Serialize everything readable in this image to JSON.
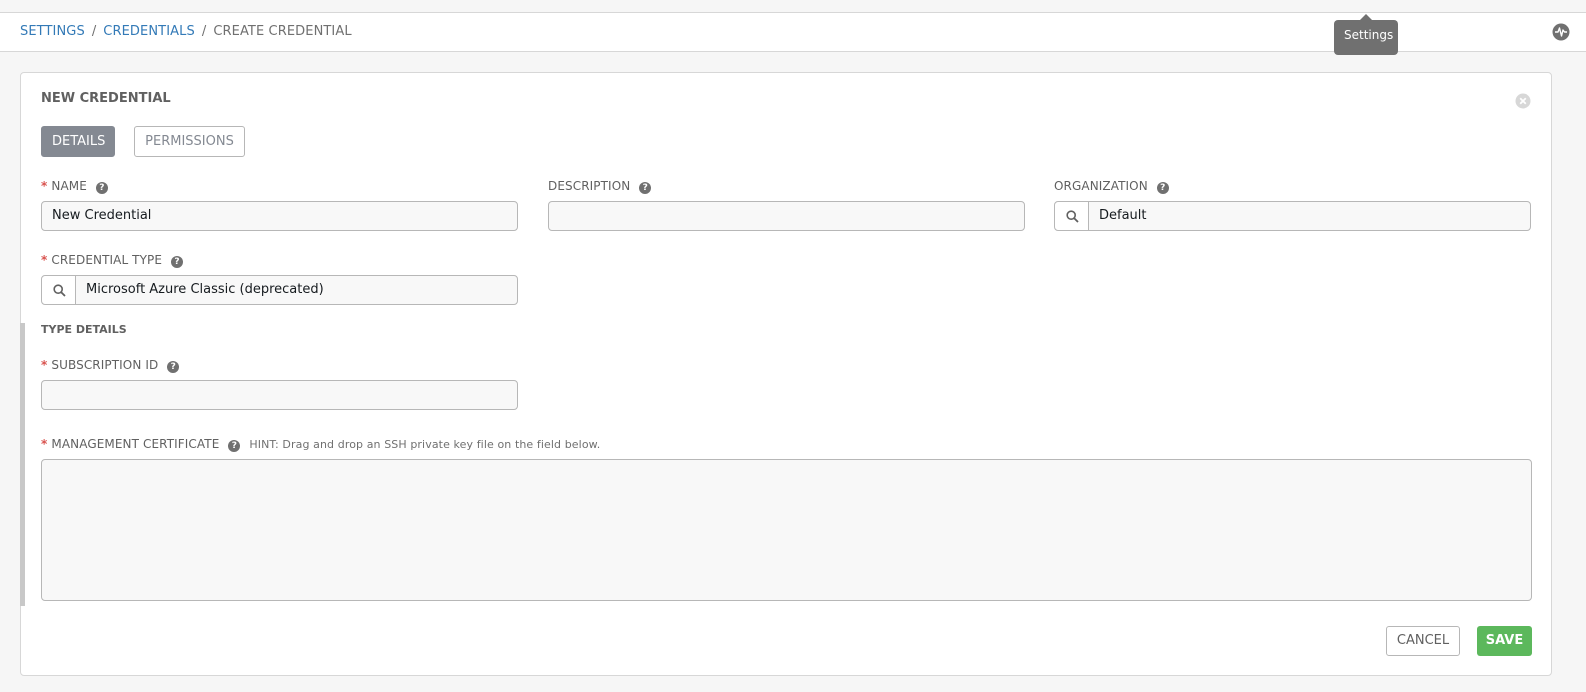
{
  "breadcrumb": {
    "items": [
      "SETTINGS",
      "CREDENTIALS"
    ],
    "current": "CREATE CREDENTIAL",
    "separator": "/"
  },
  "tooltip": {
    "text": "Settings"
  },
  "panel": {
    "title": "NEW CREDENTIAL",
    "tabs": [
      {
        "label": "DETAILS",
        "active": true
      },
      {
        "label": "PERMISSIONS",
        "active": false
      }
    ]
  },
  "form": {
    "name": {
      "label": "NAME",
      "required": true,
      "value": "New Credential"
    },
    "description": {
      "label": "DESCRIPTION",
      "required": false,
      "value": ""
    },
    "organization": {
      "label": "ORGANIZATION",
      "required": false,
      "value": "Default"
    },
    "credential_type": {
      "label": "CREDENTIAL TYPE",
      "required": true,
      "value": "Microsoft Azure Classic (deprecated)"
    },
    "type_details": {
      "title": "TYPE DETAILS"
    },
    "subscription_id": {
      "label": "SUBSCRIPTION ID",
      "required": true,
      "value": ""
    },
    "management_certificate": {
      "label": "MANAGEMENT CERTIFICATE",
      "required": true,
      "hint": "HINT: Drag and drop an SSH private key file on the field below.",
      "value": ""
    },
    "help_glyph": "?",
    "required_marker": "*"
  },
  "actions": {
    "cancel_label": "CANCEL",
    "save_label": "SAVE"
  },
  "colors": {
    "link": "#337ab7",
    "save": "#5cb85c",
    "active_tab": "#848992",
    "required": "#d9534f"
  },
  "icons": [
    "activity-icon",
    "close-circle-icon",
    "search-icon",
    "help-icon"
  ]
}
